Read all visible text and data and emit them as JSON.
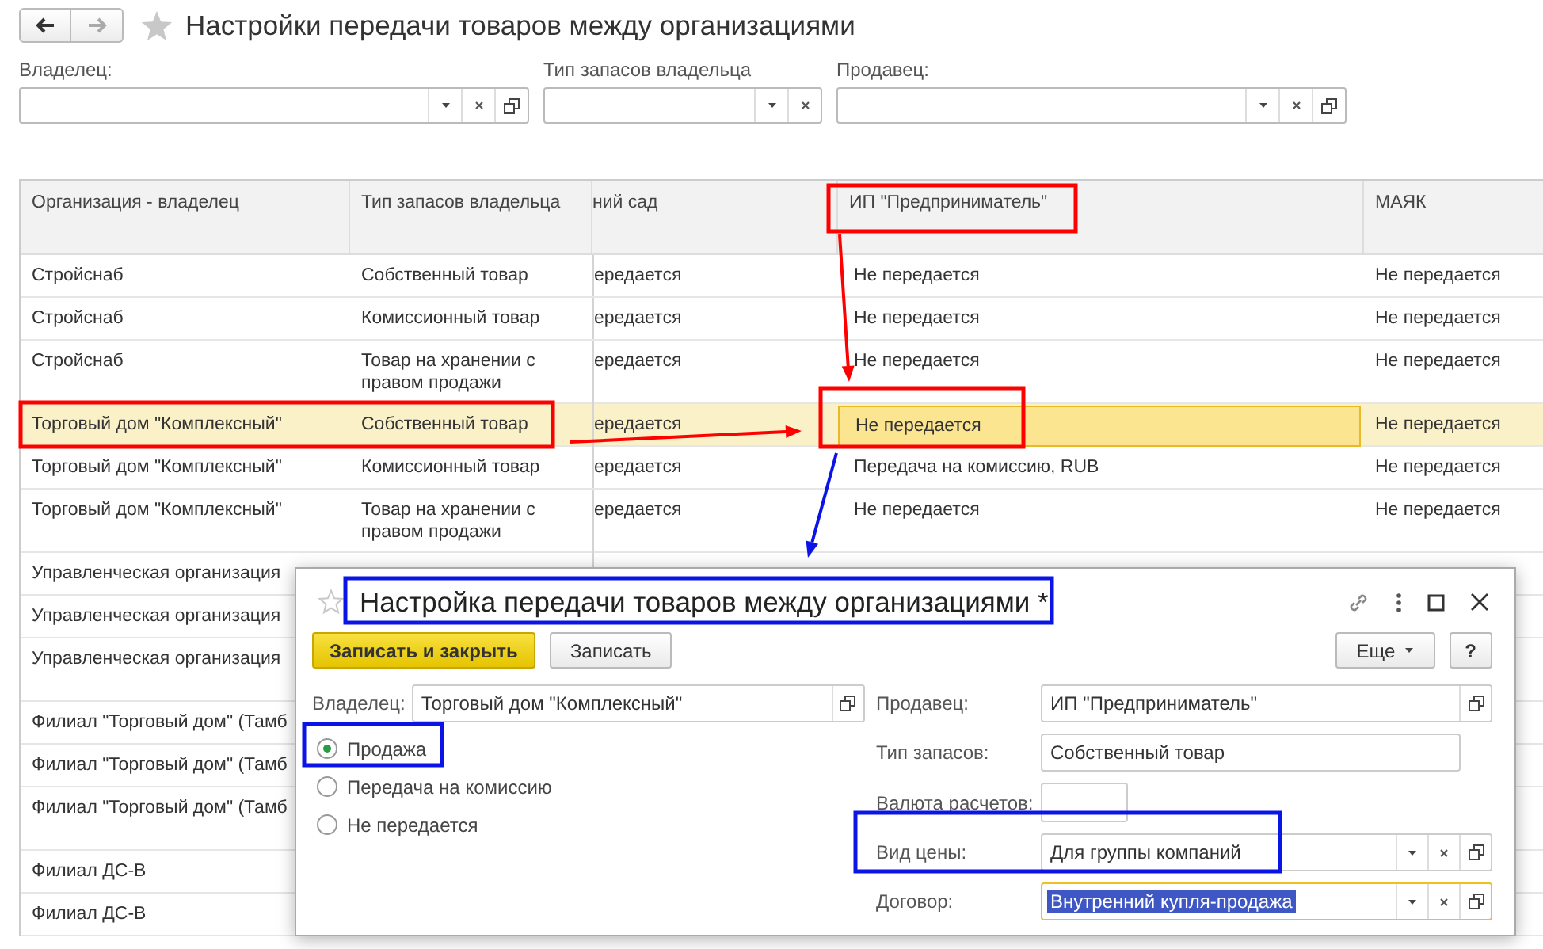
{
  "window": {
    "title": "Настройки передачи товаров между организациями"
  },
  "nav": [
    {
      "kind": "back",
      "disabled": false
    },
    {
      "kind": "forward",
      "disabled": true
    }
  ],
  "filters": [
    {
      "label": "Владелец:",
      "open_button": true
    },
    {
      "label": "Тип запасов владельца",
      "open_button": false
    },
    {
      "label": "Продавец:",
      "open_button": true
    }
  ],
  "table": {
    "columns": [
      {
        "title": "Организация - владелец",
        "current": false,
        "clipped": false
      },
      {
        "title": "Тип запасов владельца",
        "current": false,
        "clipped": false
      },
      {
        "title": "ний сад",
        "current": false,
        "clipped": true
      },
      {
        "title": "ИП \"Предприниматель\"",
        "current": true,
        "clipped": false
      },
      {
        "title": "МАЯК",
        "current": false,
        "clipped": false
      }
    ],
    "rows": [
      {
        "selected": false,
        "tall": false,
        "cells": [
          "Стройснаб",
          "Собственный товар",
          "ередается",
          "Не передается",
          "Не передается"
        ]
      },
      {
        "selected": false,
        "tall": false,
        "cells": [
          "Стройснаб",
          "Комиссионный товар",
          "ередается",
          "Не передается",
          "Не передается"
        ]
      },
      {
        "selected": false,
        "tall": true,
        "cells": [
          "Стройснаб",
          "Товар на хранении с правом продажи",
          "ередается",
          "Не передается",
          "Не передается"
        ]
      },
      {
        "selected": true,
        "tall": false,
        "cells": [
          "Торговый дом \"Комплексный\"",
          "Собственный товар",
          "ередается",
          "Не передается",
          "Не передается"
        ]
      },
      {
        "selected": false,
        "tall": false,
        "cells": [
          "Торговый дом \"Комплексный\"",
          "Комиссионный товар",
          "ередается",
          "Передача на комиссию, RUB",
          "Не передается"
        ]
      },
      {
        "selected": false,
        "tall": true,
        "cells": [
          "Торговый дом \"Комплексный\"",
          "Товар на хранении с правом продажи",
          "ередается",
          "Не передается",
          "Не передается"
        ]
      },
      {
        "selected": false,
        "tall": false,
        "cells": [
          "Управленческая организация"
        ]
      },
      {
        "selected": false,
        "tall": false,
        "cells": [
          "Управленческая организация"
        ]
      },
      {
        "selected": false,
        "tall": true,
        "cells": [
          "Управленческая организация"
        ]
      },
      {
        "selected": false,
        "tall": false,
        "cells": [
          "Филиал \"Торговый дом\" (Тамб"
        ]
      },
      {
        "selected": false,
        "tall": false,
        "cells": [
          "Филиал \"Торговый дом\" (Тамб"
        ]
      },
      {
        "selected": false,
        "tall": true,
        "cells": [
          "Филиал \"Торговый дом\" (Тамб"
        ]
      },
      {
        "selected": false,
        "tall": false,
        "cells": [
          "Филиал ДС-В"
        ]
      },
      {
        "selected": false,
        "tall": false,
        "cells": [
          "Филиал ДС-В"
        ]
      }
    ]
  },
  "dialog": {
    "title": "Настройка передачи товаров между организациями *",
    "buttons": [
      {
        "label": "Записать и закрыть",
        "default": true
      },
      {
        "label": "Записать",
        "default": false
      }
    ],
    "more": "Еще",
    "help": "?",
    "owner": {
      "label": "Владелец:",
      "value": "Торговый дом \"Комплексный\""
    },
    "options": [
      {
        "label": "Продажа",
        "selected": true
      },
      {
        "label": "Передача на комиссию",
        "selected": false
      },
      {
        "label": "Не передается",
        "selected": false
      }
    ],
    "fields": [
      {
        "kind": "open",
        "label": "Продавец:",
        "value": "ИП \"Предприниматель\"",
        "focused": false
      },
      {
        "kind": "plain",
        "label": "Тип запасов:",
        "value": "Собственный товар",
        "focused": false
      },
      {
        "kind": "short",
        "label": "Валюта расчетов:",
        "focused": false
      },
      {
        "kind": "select",
        "label": "Вид цены:",
        "value": "Для группы компаний",
        "focused": false
      },
      {
        "kind": "select",
        "label": "Договор:",
        "value": "Внутренний купля-продажа",
        "focused": true
      }
    ]
  },
  "annotations": [
    {
      "kind": "frame",
      "color": "#ff0000"
    },
    {
      "kind": "frame",
      "color": "#ff0000"
    },
    {
      "kind": "frame",
      "color": "#ff0000"
    },
    {
      "kind": "frame",
      "color": "#0a14e6"
    },
    {
      "kind": "frame",
      "color": "#0a14e6"
    },
    {
      "kind": "frame",
      "color": "#0a14e6"
    },
    {
      "kind": "arrow",
      "color": "#ff0000"
    },
    {
      "kind": "arrow",
      "color": "#ff0000"
    },
    {
      "kind": "arrow",
      "color": "#0a14e6"
    }
  ]
}
